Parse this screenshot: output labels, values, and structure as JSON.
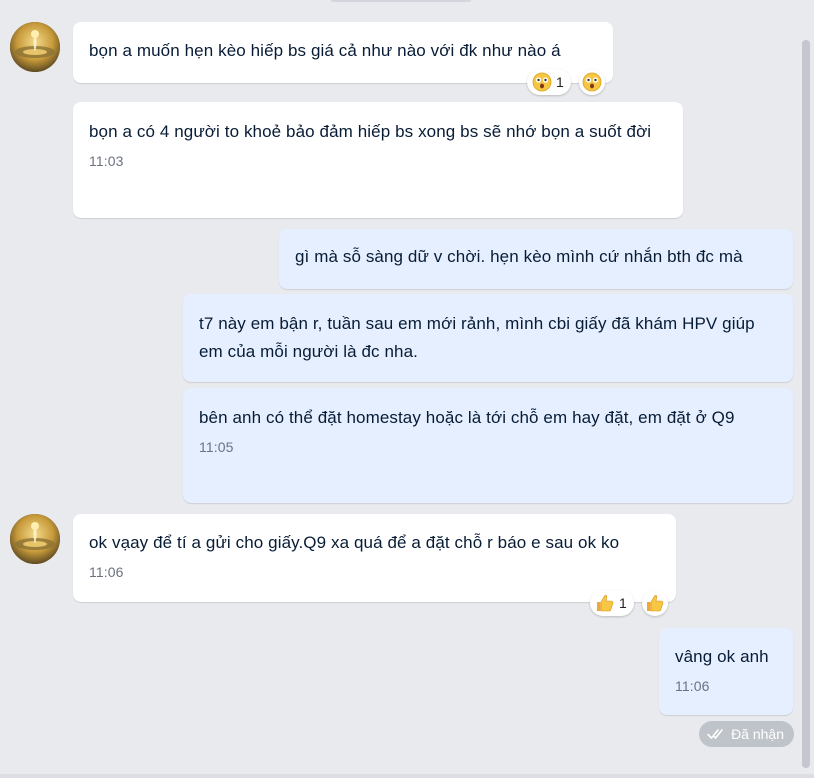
{
  "messages": [
    {
      "text": "bọn a muốn hẹn kèo hiếp bs giá cả như nào với đk như nào á",
      "reaction_count": "1",
      "reaction_icon": "shocked-face-icon"
    },
    {
      "text": "bọn a có 4 người to khoẻ bảo đảm hiếp bs xong bs sẽ nhớ bọn a suốt đời",
      "time": "11:03"
    },
    {
      "text": "gì mà sỗ sàng dữ v chời. hẹn kèo mình cứ nhắn bth đc mà"
    },
    {
      "text": "t7 này em bận r, tuần sau em mới rảnh, mình cbi giấy đã khám HPV giúp em của mỗi người là đc nha."
    },
    {
      "text": "bên anh có thể đặt homestay hoặc là tới chỗ em hay đặt, em đặt ở Q9",
      "time": "11:05"
    },
    {
      "text": "ok vạay để tí a gửi cho giấy.Q9 xa quá để a đặt chỗ r báo e sau ok ko",
      "time": "11:06",
      "reaction_count": "1",
      "reaction_icon": "thumbs-up-icon"
    },
    {
      "text": "vâng ok anh",
      "time": "11:06"
    }
  ],
  "status": {
    "label": "Đã nhận",
    "icon": "double-check-icon"
  },
  "colors": {
    "background": "#e9eaee",
    "incoming_bubble": "#ffffff",
    "outgoing_bubble": "#e5efff",
    "text": "#081c36",
    "time": "#6b7380"
  }
}
